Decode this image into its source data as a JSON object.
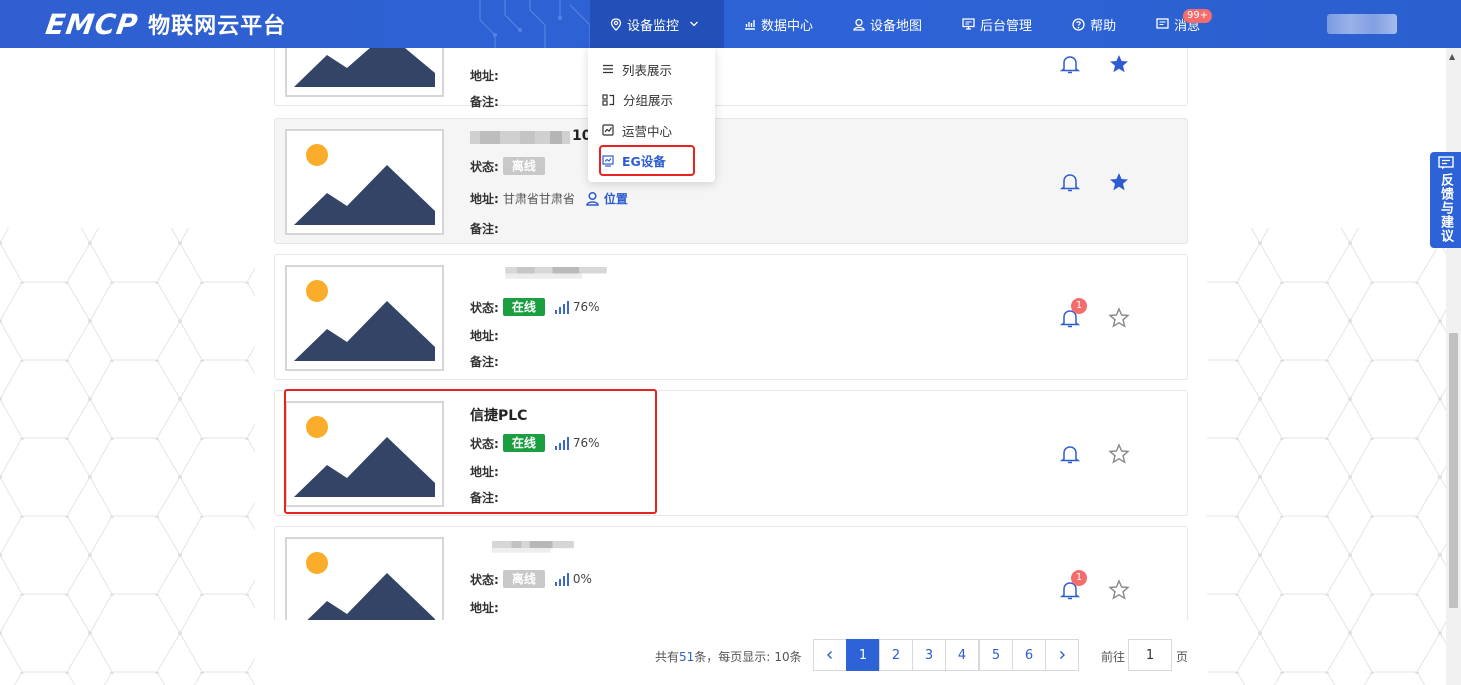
{
  "header": {
    "logo_mark": "EMCP",
    "logo_text": "物联网云平台",
    "nav": [
      {
        "label": "设备监控",
        "icon": "location-pin-icon"
      },
      {
        "label": "数据中心",
        "icon": "chart-icon"
      },
      {
        "label": "设备地图",
        "icon": "user-pin-icon"
      },
      {
        "label": "后台管理",
        "icon": "monitor-icon"
      },
      {
        "label": "帮助",
        "icon": "help-icon"
      },
      {
        "label": "消息",
        "icon": "message-icon",
        "badge": "99+"
      }
    ]
  },
  "dropdown": {
    "items": [
      {
        "label": "列表展示",
        "icon": "list-icon"
      },
      {
        "label": "分组展示",
        "icon": "group-icon"
      },
      {
        "label": "运营中心",
        "icon": "operation-icon"
      },
      {
        "label": "EG设备",
        "icon": "eg-device-icon"
      }
    ]
  },
  "labels": {
    "status": "状态:",
    "address": "地址:",
    "remark": "备注:",
    "location": "位置"
  },
  "devices": [
    {
      "name": "",
      "status": "",
      "signal": "",
      "address": "",
      "remark": "",
      "alarm_badge": "",
      "favorite": true
    },
    {
      "name": "10",
      "status": "离线",
      "signal": "",
      "address": "甘肃省甘肃省",
      "remark": "",
      "alarm_badge": "",
      "favorite": true
    },
    {
      "name": "",
      "status": "在线",
      "signal": "76%",
      "address": "",
      "remark": "",
      "alarm_badge": "1",
      "favorite": false
    },
    {
      "name": "信捷PLC",
      "status": "在线",
      "signal": "76%",
      "address": "",
      "remark": "",
      "alarm_badge": "",
      "favorite": false
    },
    {
      "name": "",
      "status": "离线",
      "signal": "0%",
      "address": "",
      "remark": "",
      "alarm_badge": "1",
      "favorite": false
    }
  ],
  "pagination": {
    "total_prefix": "共有",
    "total": "51",
    "total_mid": "条，每页显示:",
    "per_page": "10条",
    "pages": [
      "1",
      "2",
      "3",
      "4",
      "5",
      "6"
    ],
    "current": "1",
    "goto_prefix": "前往",
    "goto_value": "1",
    "goto_suffix": "页"
  },
  "feedback": {
    "label": "反馈与建议"
  },
  "colors": {
    "primary": "#2d63d6",
    "online": "#1a9e3f",
    "offline": "#c8c8c8",
    "badge": "#f56c6c",
    "highlight": "#e8231f"
  }
}
